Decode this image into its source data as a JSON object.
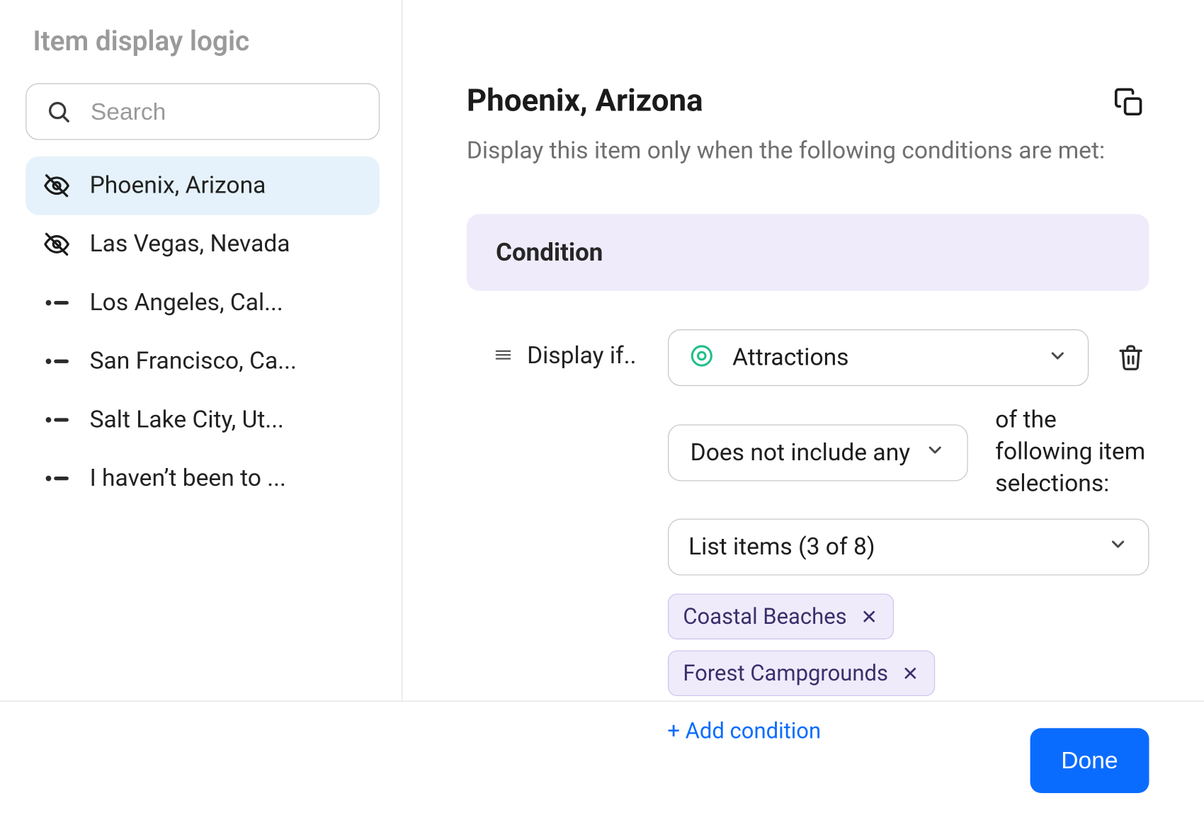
{
  "sidebar": {
    "title": "Item display logic",
    "search_placeholder": "Search",
    "items": [
      {
        "label": "Phoenix, Arizona",
        "icon": "hidden",
        "active": true
      },
      {
        "label": "Las Vegas, Nevada",
        "icon": "hidden",
        "active": false
      },
      {
        "label": "Los Angeles, Cal...",
        "icon": "bullet",
        "active": false
      },
      {
        "label": "San Francisco, Ca...",
        "icon": "bullet",
        "active": false
      },
      {
        "label": "Salt Lake City, Ut...",
        "icon": "bullet",
        "active": false
      },
      {
        "label": "I haven’t been to ...",
        "icon": "bullet",
        "active": false
      }
    ]
  },
  "header": {
    "title": "Phoenix, Arizona",
    "subtitle": "Display this item only when the following conditions are met:"
  },
  "condition": {
    "section_label": "Condition",
    "display_if_label": "Display if..",
    "field": "Attractions",
    "operator": "Does not include any",
    "trailing_text": "of the following item selections:",
    "items_summary": "List items (3 of 8)",
    "chips": [
      "Coastal Beaches",
      "Forest Campgrounds"
    ],
    "add_condition_label": "+ Add condition"
  },
  "footer": {
    "done_label": "Done"
  }
}
